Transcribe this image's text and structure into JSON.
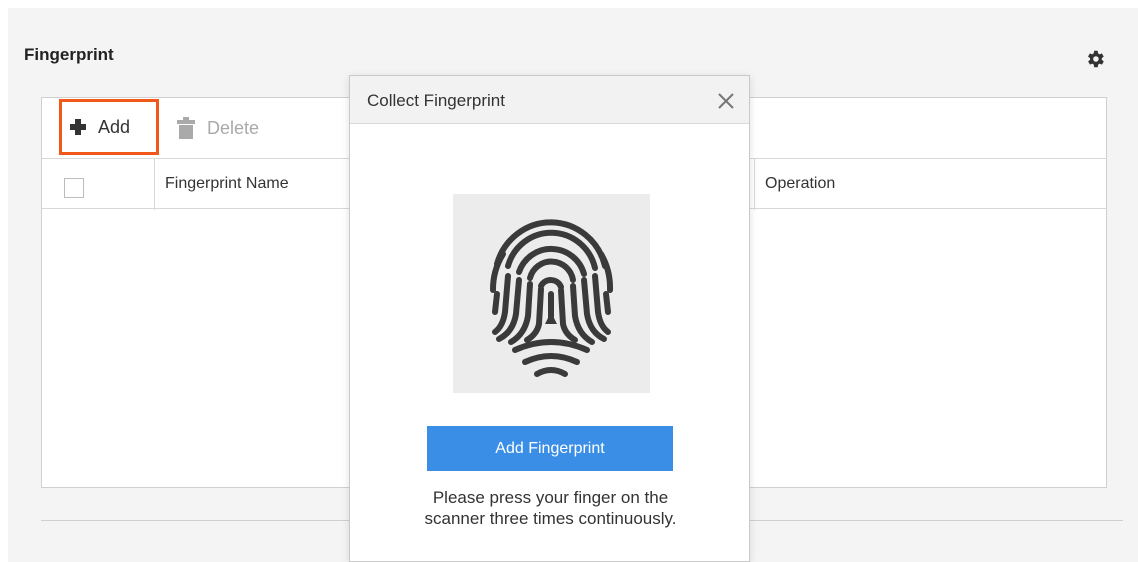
{
  "page": {
    "title": "Fingerprint",
    "settings_icon": "gear-icon"
  },
  "toolbar": {
    "add_label": "Add",
    "add_icon": "plus-icon",
    "delete_label": "Delete",
    "delete_icon": "trash-icon",
    "highlight_color": "#f0591a"
  },
  "table": {
    "columns": [
      "",
      "Fingerprint Name",
      "Operation"
    ],
    "rows": []
  },
  "modal": {
    "title": "Collect Fingerprint",
    "close_icon": "close-icon",
    "image_icon": "fingerprint-icon",
    "button_label": "Add Fingerprint",
    "button_color": "#3a8ee6",
    "hint_line1": "Please press your finger on the",
    "hint_line2": "scanner three times continuously."
  }
}
